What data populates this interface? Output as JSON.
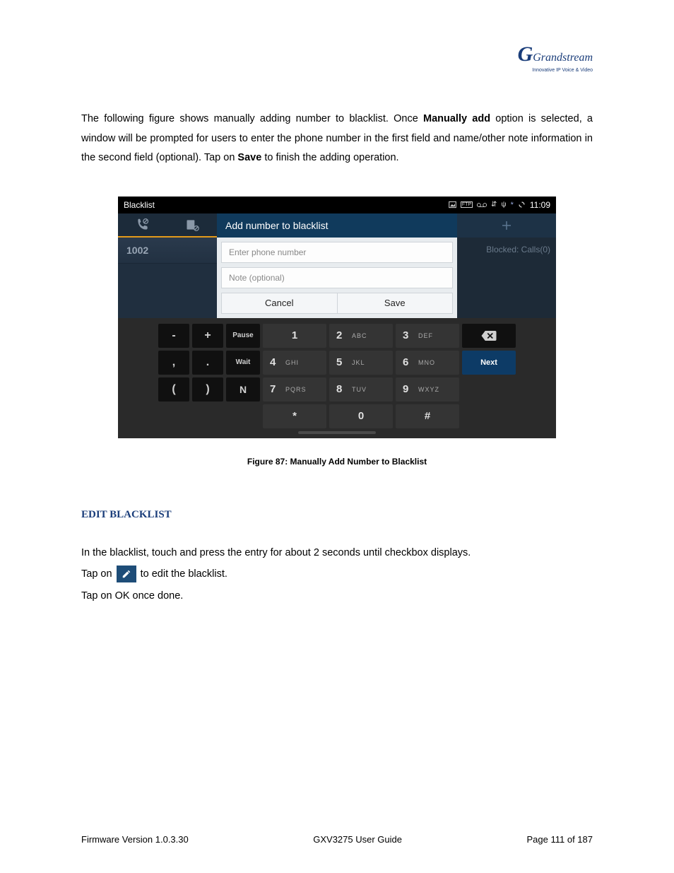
{
  "logo": {
    "name": "Grandstream",
    "tagline": "Innovative IP Voice & Video"
  },
  "intro": {
    "pre": "The following figure shows manually adding number to blacklist. Once ",
    "b1": "Manually add",
    "mid": " option is selected, a window will be prompted for users to enter the phone number in the first field and name/other note information in the second field (optional). Tap on ",
    "b2": "Save",
    "post": " to finish the adding operation."
  },
  "shot": {
    "status_title": "Blacklist",
    "status_time": "11:09",
    "dialog_title": "Add number to blacklist",
    "left_entry": "1002",
    "right_blocked": "Blocked: Calls(0)",
    "input1_placeholder": "Enter phone number",
    "input2_placeholder": "Note (optional)",
    "cancel": "Cancel",
    "save": "Save",
    "keys": {
      "minus": "-",
      "plus": "+",
      "pause": "Pause",
      "comma": ",",
      "dot": ".",
      "wait": "Wait",
      "lparen": "(",
      "rparen": ")",
      "n": "N",
      "star": "*",
      "hash": "#",
      "next": "Next",
      "d1": "1",
      "d2": "2",
      "l2": "ABC",
      "d3": "3",
      "l3": "DEF",
      "d4": "4",
      "l4": "GHI",
      "d5": "5",
      "l5": "JKL",
      "d6": "6",
      "l6": "MNO",
      "d7": "7",
      "l7": "PQRS",
      "d8": "8",
      "l8": "TUV",
      "d9": "9",
      "l9": "WXYZ",
      "d0": "0"
    }
  },
  "caption": "Figure 87: Manually Add Number to Blacklist",
  "section_heading": "EDIT BLACKLIST",
  "edit": {
    "line1": "In the blacklist, touch and press the entry for about 2 seconds until checkbox displays.",
    "line2a": "Tap on ",
    "line2b": " to edit the blacklist.",
    "line3": "Tap on OK once done."
  },
  "footer": {
    "left": "Firmware Version 1.0.3.30",
    "center": "GXV3275 User Guide",
    "right": "Page 111 of 187"
  }
}
